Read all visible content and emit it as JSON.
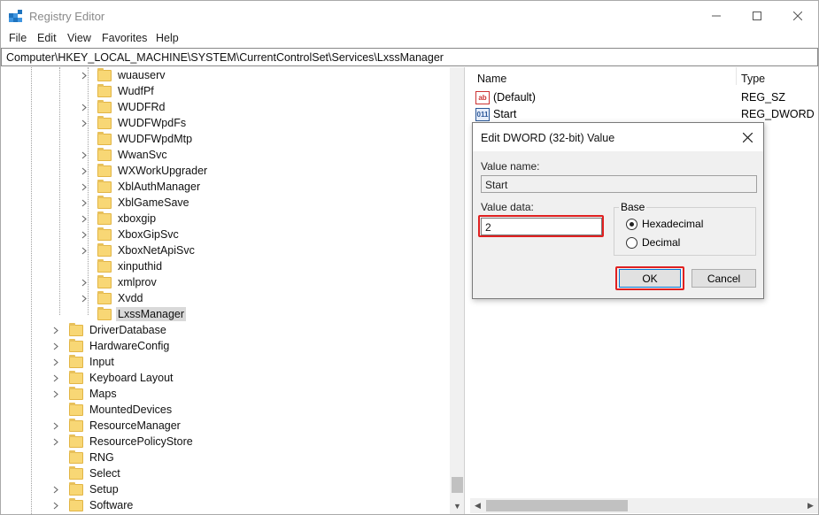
{
  "window": {
    "title": "Registry Editor",
    "controls": {
      "minimize": "—",
      "maximize": "☐",
      "close": "✕"
    }
  },
  "menu": [
    "File",
    "Edit",
    "View",
    "Favorites",
    "Help"
  ],
  "address": "Computer\\HKEY_LOCAL_MACHINE\\SYSTEM\\CurrentControlSet\\Services\\LxssManager",
  "tree": {
    "deep_items": [
      {
        "label": "wuauserv",
        "expandable": true
      },
      {
        "label": "WudfPf",
        "expandable": false
      },
      {
        "label": "WUDFRd",
        "expandable": true
      },
      {
        "label": "WUDFWpdFs",
        "expandable": true
      },
      {
        "label": "WUDFWpdMtp",
        "expandable": false
      },
      {
        "label": "WwanSvc",
        "expandable": true
      },
      {
        "label": "WXWorkUpgrader",
        "expandable": true
      },
      {
        "label": "XblAuthManager",
        "expandable": true
      },
      {
        "label": "XblGameSave",
        "expandable": true
      },
      {
        "label": "xboxgip",
        "expandable": true
      },
      {
        "label": "XboxGipSvc",
        "expandable": true
      },
      {
        "label": "XboxNetApiSvc",
        "expandable": true
      },
      {
        "label": "xinputhid",
        "expandable": false
      },
      {
        "label": "xmlprov",
        "expandable": true
      },
      {
        "label": "Xvdd",
        "expandable": true
      },
      {
        "label": "LxssManager",
        "expandable": false,
        "selected": true
      }
    ],
    "shallow_items": [
      {
        "label": "DriverDatabase",
        "expandable": true
      },
      {
        "label": "HardwareConfig",
        "expandable": true
      },
      {
        "label": "Input",
        "expandable": true
      },
      {
        "label": "Keyboard Layout",
        "expandable": true
      },
      {
        "label": "Maps",
        "expandable": true
      },
      {
        "label": "MountedDevices",
        "expandable": false
      },
      {
        "label": "ResourceManager",
        "expandable": true
      },
      {
        "label": "ResourcePolicyStore",
        "expandable": true
      },
      {
        "label": "RNG",
        "expandable": false
      },
      {
        "label": "Select",
        "expandable": false
      },
      {
        "label": "Setup",
        "expandable": true
      },
      {
        "label": "Software",
        "expandable": true
      }
    ]
  },
  "list": {
    "headers": {
      "name": "Name",
      "type": "Type"
    },
    "rows": [
      {
        "name": "(Default)",
        "type": "REG_SZ",
        "icon": "string-value-icon",
        "badge": "ab"
      },
      {
        "name": "Start",
        "type": "REG_DWORD",
        "icon": "dword-value-icon",
        "badge": "011"
      }
    ]
  },
  "dialog": {
    "title": "Edit DWORD (32-bit) Value",
    "value_name_label": "Value name:",
    "value_name": "Start",
    "value_data_label": "Value data:",
    "value_data": "2",
    "base_label": "Base",
    "radio_hex": "Hexadecimal",
    "radio_dec": "Decimal",
    "selected_base": "Hexadecimal",
    "ok": "OK",
    "cancel": "Cancel",
    "highlight_color": "#e02020"
  }
}
